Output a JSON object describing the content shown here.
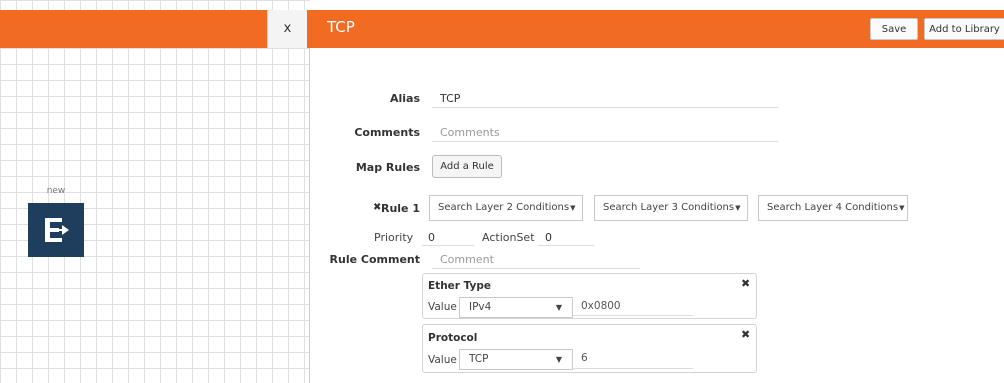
{
  "header": {
    "close_label": "x",
    "title": "TCP",
    "save_label": "Save",
    "add_to_library_label": "Add to Library"
  },
  "canvas": {
    "node_label": "new",
    "node_icon": "ether-type-map-icon",
    "node_color": "#1f3d5c"
  },
  "form": {
    "alias_label": "Alias",
    "alias_value": "TCP",
    "comments_label": "Comments",
    "comments_placeholder": "Comments",
    "map_rules_label": "Map Rules",
    "add_rule_label": "Add a Rule"
  },
  "rule": {
    "remove_icon": "✖",
    "label": "Rule 1",
    "l2_placeholder": "Search Layer 2 Conditions",
    "l3_placeholder": "Search Layer 3 Conditions",
    "l4_placeholder": "Search Layer 4 Conditions",
    "priority_label": "Priority",
    "priority_value": "0",
    "actionset_label": "ActionSet",
    "actionset_value": "0",
    "comment_label": "Rule Comment",
    "comment_placeholder": "Comment",
    "conditions": [
      {
        "title": "Ether Type",
        "value_label": "Value",
        "selected": "IPv4",
        "hex": "0x0800"
      },
      {
        "title": "Protocol",
        "value_label": "Value",
        "selected": "TCP",
        "hex": "6"
      }
    ]
  },
  "colors": {
    "header_orange": "#f26b22",
    "node_navy": "#1f3d5c"
  }
}
